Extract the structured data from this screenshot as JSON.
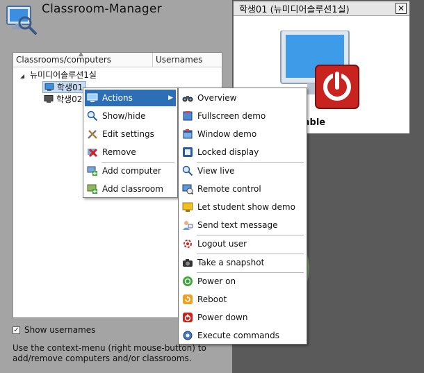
{
  "app": {
    "title": "Classroom-Manager"
  },
  "tree": {
    "columns": [
      "Classrooms/computers",
      "Usernames"
    ],
    "classroom": "뉴미디어솔루션1실",
    "computers": [
      "학생01",
      "학생02"
    ]
  },
  "show_usernames": {
    "label": "Show usernames",
    "checked": true,
    "check_glyph": "✓"
  },
  "help": {
    "text": "Use the context-menu (right mouse-button) to add/remove computers and/or classrooms."
  },
  "status_window": {
    "title": "학생01 (뉴미디어솔루션1실)",
    "close_glyph": "✕",
    "status": "Unreachable"
  },
  "context_menu": {
    "items": [
      {
        "label": "Actions",
        "icon": "monitor-icon",
        "has_submenu": true
      },
      {
        "label": "Show/hide",
        "icon": "magnifier-icon"
      },
      {
        "label": "Edit settings",
        "icon": "tools-icon"
      },
      {
        "label": "Remove",
        "icon": "remove-x-icon"
      },
      {
        "label": "Add computer",
        "icon": "add-computer-icon"
      },
      {
        "label": "Add classroom",
        "icon": "add-classroom-icon"
      }
    ],
    "arrow_glyph": "▶"
  },
  "actions_menu": {
    "items": [
      {
        "label": "Overview",
        "icon": "binoculars-icon"
      },
      {
        "label": "Fullscreen demo",
        "icon": "fullscreen-demo-icon"
      },
      {
        "label": "Window demo",
        "icon": "window-demo-icon"
      },
      {
        "label": "Locked display",
        "icon": "lock-display-icon"
      },
      {
        "label": "View live",
        "icon": "magnifier-icon"
      },
      {
        "label": "Remote control",
        "icon": "remote-control-icon"
      },
      {
        "label": "Let student show demo",
        "icon": "student-demo-icon"
      },
      {
        "label": "Send text message",
        "icon": "message-icon"
      },
      {
        "label": "Logout user",
        "icon": "logout-icon"
      },
      {
        "label": "Take a snapshot",
        "icon": "camera-icon"
      },
      {
        "label": "Power on",
        "icon": "power-on-icon"
      },
      {
        "label": "Reboot",
        "icon": "reboot-icon"
      },
      {
        "label": "Power down",
        "icon": "power-down-icon"
      },
      {
        "label": "Execute commands",
        "icon": "gear-icon"
      }
    ]
  },
  "colors": {
    "selection": "#2d6fb6",
    "panel_bg": "#a4a4a4",
    "background": "#5a5a5a"
  }
}
